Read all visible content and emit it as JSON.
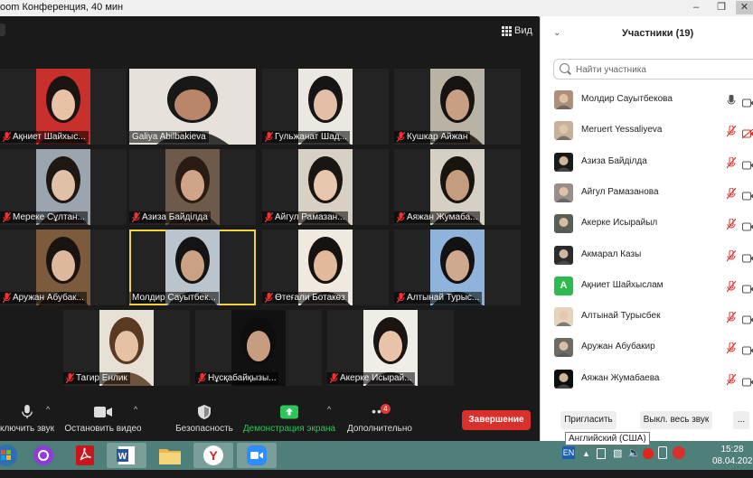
{
  "window": {
    "title": "oom Конференция, 40 мин",
    "controls": [
      "minimize-icon",
      "maximize-icon",
      "close-icon"
    ]
  },
  "meeting": {
    "view_label": "Вид",
    "tiles": [
      {
        "name": "Ақниет Шайхыс...",
        "muted": true,
        "skin": "#e8c2a6",
        "bg": "#c9302c",
        "hair": "#1c1410"
      },
      {
        "name": "Galiya Abilbakieva",
        "muted": false,
        "skin": "#b8876a",
        "bg": "#e6e1da",
        "hair": "#181818",
        "wide": true
      },
      {
        "name": "Гульжанат Шад...",
        "muted": true,
        "skin": "#e2bfa6",
        "bg": "#ebe7e1",
        "hair": "#151515"
      },
      {
        "name": "Кушкар Айжан",
        "muted": true,
        "skin": "#c99f84",
        "bg": "#b9b3a6",
        "hair": "#171310"
      },
      {
        "name": "Мереке Сұлтан...",
        "muted": true,
        "skin": "#e0c0a6",
        "bg": "#9aa5ad",
        "hair": "#1f1712"
      },
      {
        "name": "Азиза Байділда",
        "muted": true,
        "skin": "#d0a488",
        "bg": "#6d5a4a",
        "hair": "#2a1c14"
      },
      {
        "name": "Айгул Рамазан...",
        "muted": true,
        "skin": "#e6c7ae",
        "bg": "#d8d0c4",
        "hair": "#191512"
      },
      {
        "name": "Аяжан Жумаба...",
        "muted": true,
        "skin": "#c59c7e",
        "bg": "#d6cfc3",
        "hair": "#181410"
      },
      {
        "name": "Аружан Абубак...",
        "muted": true,
        "skin": "#ddb89c",
        "bg": "#7b5b3c",
        "hair": "#1a1410"
      },
      {
        "name": "Молдир Сауытбек...",
        "muted": false,
        "skin": "#caa183",
        "bg": "#b9c4cc",
        "hair": "#141414",
        "speaking": true
      },
      {
        "name": "Өтеғали Ботакөз",
        "muted": true,
        "skin": "#e3b99c",
        "bg": "#efe9e0",
        "hair": "#161210"
      },
      {
        "name": "Алтынай Турыс...",
        "muted": true,
        "skin": "#cfa98f",
        "bg": "#8fb3da",
        "hair": "#121212"
      },
      {
        "name": "Тагир Енлик",
        "muted": true,
        "skin": "#e5c2a4",
        "bg": "#e7e0d5",
        "hair": "#5a3a22"
      },
      {
        "name": "Нұсқабайқызы...",
        "muted": true,
        "skin": "#c79d80",
        "bg": "#111111",
        "hair": "#0d0d0d"
      },
      {
        "name": "Акерке Исырай...",
        "muted": true,
        "skin": "#e8c3a8",
        "bg": "#f0ece6",
        "hair": "#1a1512"
      }
    ]
  },
  "toolbar": {
    "audio_label": "ключить звук",
    "video_label": "Остановить видео",
    "security_label": "Безопасность",
    "share_label": "Демонстрация экрана",
    "more_label": "Дополнительно",
    "more_badge": "4",
    "end_label": "Завершение"
  },
  "participants": {
    "title": "Участники (19)",
    "search_placeholder": "Найти участника",
    "list": [
      {
        "name": "Молдир Сауытбекова",
        "muted": false,
        "video_off": false,
        "avatar": "photo",
        "color": "#b08f7a"
      },
      {
        "name": "Meruert Yessaliyeva",
        "muted": true,
        "video_off": true,
        "avatar": "photo",
        "color": "#c7b199"
      },
      {
        "name": "Азиза Байділда",
        "muted": true,
        "video_off": false,
        "avatar": "photo",
        "color": "#1a1a1a"
      },
      {
        "name": "Айгул Рамазанова",
        "muted": true,
        "video_off": false,
        "avatar": "photo",
        "color": "#9a8f88"
      },
      {
        "name": "Акерке Исырайыл",
        "muted": true,
        "video_off": false,
        "avatar": "photo",
        "color": "#5a5f52"
      },
      {
        "name": "Акмарал Казы",
        "muted": true,
        "video_off": false,
        "avatar": "photo",
        "color": "#2b2b2b"
      },
      {
        "name": "Ақниет Шайхыслам",
        "muted": true,
        "video_off": false,
        "avatar": "letter",
        "letter": "А",
        "color": "#2dba4e"
      },
      {
        "name": "Алтынай Турысбек",
        "muted": true,
        "video_off": false,
        "avatar": "photo",
        "color": "#e6d3bb"
      },
      {
        "name": "Аружан Абубакир",
        "muted": true,
        "video_off": false,
        "avatar": "photo",
        "color": "#6f6a62"
      },
      {
        "name": "Аяжан Жумабаева",
        "muted": true,
        "video_off": false,
        "avatar": "photo",
        "color": "#0e0e0e"
      }
    ],
    "invite_label": "Пригласить",
    "mute_all_label": "Выкл. весь звук",
    "more_label": "..."
  },
  "tooltip": {
    "text": "Английский (США)"
  },
  "taskbar": {
    "apps": [
      "start-orb-icon",
      "alice-assistant-icon",
      "pdf-reader-icon",
      "word-icon",
      "folder-icon",
      "yandex-browser-icon",
      "zoom-icon"
    ],
    "lang": "EN",
    "time": "15:28",
    "date": "08.04.2021"
  },
  "colors": {
    "accent_green": "#2ec458",
    "end_red": "#d9302c",
    "taskbar": "#4e7f79",
    "mute_red": "#d9302c"
  }
}
